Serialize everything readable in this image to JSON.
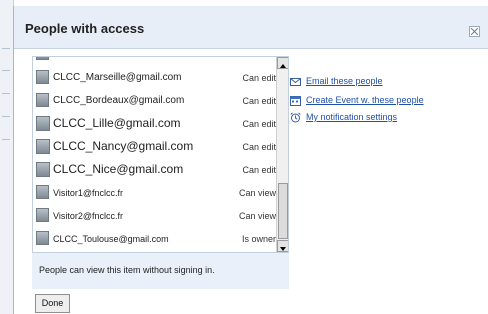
{
  "dialog": {
    "title": "People with access"
  },
  "people": [
    {
      "email": "",
      "role": ""
    },
    {
      "email": "CLCC_Marseille@gmail.com",
      "role": "Can edit"
    },
    {
      "email": "CLCC_Bordeaux@gmail.com",
      "role": "Can edit"
    },
    {
      "email": "CLCC_Lille@gmail.com",
      "role": "Can edit"
    },
    {
      "email": "CLCC_Nancy@gmail.com",
      "role": "Can edit"
    },
    {
      "email": "CLCC_Nice@gmail.com",
      "role": "Can edit"
    },
    {
      "email": "Visitor1@fnclcc.fr",
      "role": "Can view"
    },
    {
      "email": "Visitor2@fnclcc.fr",
      "role": "Can view"
    },
    {
      "email": "CLCC_Toulouse@gmail.com",
      "role": "Is owner"
    }
  ],
  "note": "People can view this item without signing in.",
  "done_label": "Done",
  "actions": [
    {
      "label": "Email these people",
      "icon": "envelope-icon"
    },
    {
      "label": "Create Event w. these people",
      "icon": "calendar-icon"
    },
    {
      "label": "My notification settings",
      "icon": "alarm-clock-icon"
    }
  ]
}
